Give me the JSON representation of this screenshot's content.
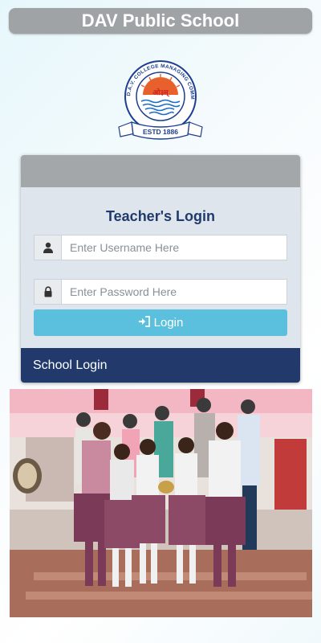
{
  "header": {
    "title": "DAV Public School"
  },
  "logo": {
    "arc_text": "D.A.V. COLLEGE MANAGING COMMITTEE",
    "center_text": "ओ३म्",
    "ribbon_text": "ESTD 1886"
  },
  "login_card": {
    "title": "Teacher's Login",
    "username": {
      "placeholder": "Enter Username Here",
      "value": ""
    },
    "password": {
      "placeholder": "Enter Password Here",
      "value": ""
    },
    "login_button": "Login",
    "school_login": "School Login"
  },
  "icons": {
    "user": "user-icon",
    "lock": "lock-icon",
    "login": "sign-in-icon"
  },
  "colors": {
    "header_bg": "#9fa3a6",
    "card_title": "#1f3a6b",
    "login_button": "#5bc0de",
    "school_login_bar": "#223a6b"
  }
}
